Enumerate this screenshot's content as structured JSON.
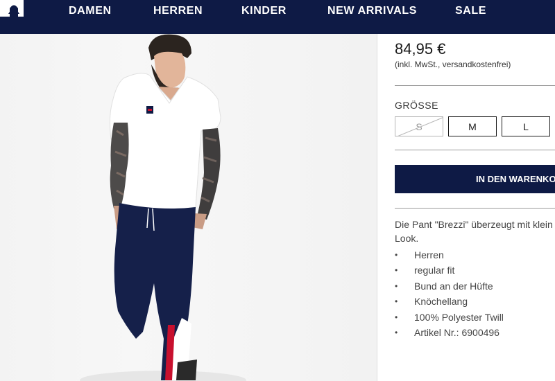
{
  "nav": {
    "logo_text": "FILA",
    "items": [
      "DAMEN",
      "HERREN",
      "KINDER",
      "NEW ARRIVALS",
      "SALE"
    ]
  },
  "product": {
    "price": "84,95 €",
    "tax_note": "(inkl. MwSt., versandkostenfrei)",
    "size_label": "GRÖSSE",
    "sizes": [
      {
        "label": "S",
        "available": false
      },
      {
        "label": "M",
        "available": true
      },
      {
        "label": "L",
        "available": true
      }
    ],
    "add_to_cart": "IN DEN WARENKORB",
    "description": "Die Pant \"Brezzi\" überzeugt mit klein",
    "description_line2": "Look.",
    "features": [
      "Herren",
      "regular fit",
      "Bund an der Hüfte",
      "Knöchellang",
      "100% Polyester Twill",
      "Artikel Nr.: 6900496"
    ]
  },
  "colors": {
    "navy": "#0e1a45",
    "stripe_red": "#c8102e"
  }
}
